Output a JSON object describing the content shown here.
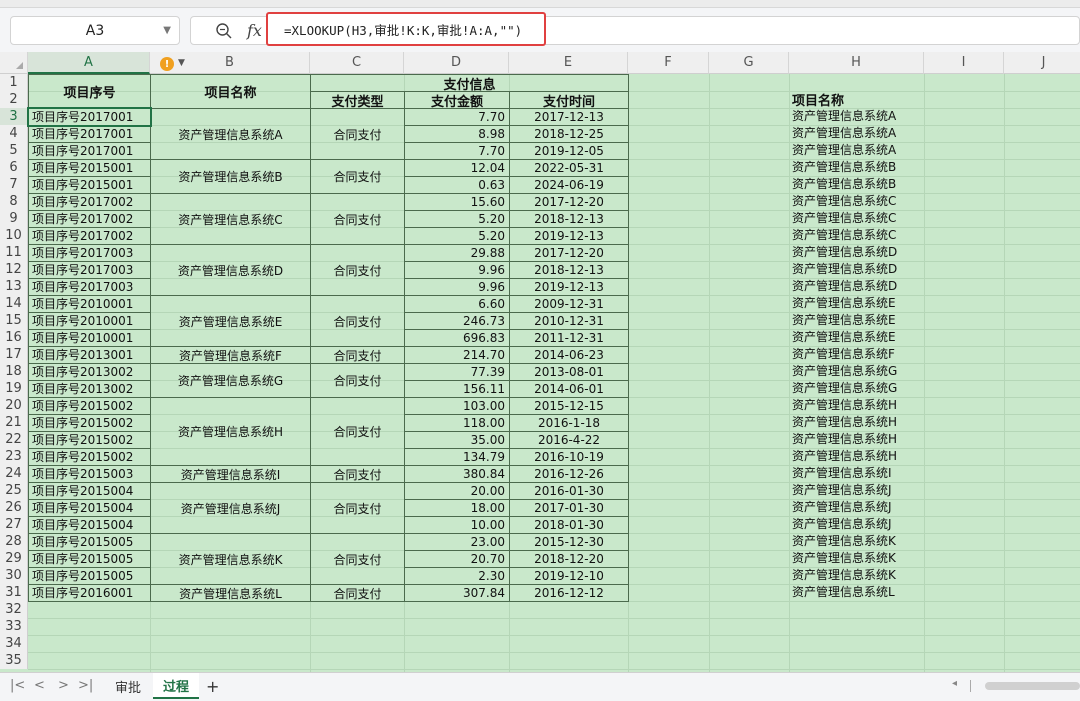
{
  "formula_bar": {
    "name_box": "A3",
    "fx_label": "fx",
    "formula": "=XLOOKUP(H3,审批!K:K,审批!A:A,\"\")"
  },
  "columns": [
    "A",
    "B",
    "C",
    "D",
    "E",
    "F",
    "G",
    "H",
    "I",
    "J"
  ],
  "row_numbers": [
    "1",
    "2",
    "3",
    "4",
    "5",
    "6",
    "7",
    "8",
    "9",
    "10",
    "11",
    "12",
    "13",
    "14",
    "15",
    "16",
    "17",
    "18",
    "19",
    "20",
    "21",
    "22",
    "23",
    "24",
    "25",
    "26",
    "27",
    "28",
    "29",
    "30",
    "31",
    "32",
    "33",
    "34",
    "35"
  ],
  "headers": {
    "project_no": "项目序号",
    "project_name": "项目名称",
    "payment_info": "支付信息",
    "payment_type": "支付类型",
    "payment_amount": "支付金额",
    "payment_time": "支付时间",
    "lookup_header": "项目名称"
  },
  "rows": [
    {
      "no": "项目序号2017001",
      "amount": "7.70",
      "date": "2017-12-13",
      "h": "资产管理信息系统A"
    },
    {
      "no": "项目序号2017001",
      "amount": "8.98",
      "date": "2018-12-25",
      "h": "资产管理信息系统A"
    },
    {
      "no": "项目序号2017001",
      "amount": "7.70",
      "date": "2019-12-05",
      "h": "资产管理信息系统A"
    },
    {
      "no": "项目序号2015001",
      "amount": "12.04",
      "date": "2022-05-31",
      "h": "资产管理信息系统B"
    },
    {
      "no": "项目序号2015001",
      "amount": "0.63",
      "date": "2024-06-19",
      "h": "资产管理信息系统B"
    },
    {
      "no": "项目序号2017002",
      "amount": "15.60",
      "date": "2017-12-20",
      "h": "资产管理信息系统C"
    },
    {
      "no": "项目序号2017002",
      "amount": "5.20",
      "date": "2018-12-13",
      "h": "资产管理信息系统C"
    },
    {
      "no": "项目序号2017002",
      "amount": "5.20",
      "date": "2019-12-13",
      "h": "资产管理信息系统C"
    },
    {
      "no": "项目序号2017003",
      "amount": "29.88",
      "date": "2017-12-20",
      "h": "资产管理信息系统D"
    },
    {
      "no": "项目序号2017003",
      "amount": "9.96",
      "date": "2018-12-13",
      "h": "资产管理信息系统D"
    },
    {
      "no": "项目序号2017003",
      "amount": "9.96",
      "date": "2019-12-13",
      "h": "资产管理信息系统D"
    },
    {
      "no": "项目序号2010001",
      "amount": "6.60",
      "date": "2009-12-31",
      "h": "资产管理信息系统E"
    },
    {
      "no": "项目序号2010001",
      "amount": "246.73",
      "date": "2010-12-31",
      "h": "资产管理信息系统E"
    },
    {
      "no": "项目序号2010001",
      "amount": "696.83",
      "date": "2011-12-31",
      "h": "资产管理信息系统E"
    },
    {
      "no": "项目序号2013001",
      "amount": "214.70",
      "date": "2014-06-23",
      "h": "资产管理信息系统F"
    },
    {
      "no": "项目序号2013002",
      "amount": "77.39",
      "date": "2013-08-01",
      "h": "资产管理信息系统G"
    },
    {
      "no": "项目序号2013002",
      "amount": "156.11",
      "date": "2014-06-01",
      "h": "资产管理信息系统G"
    },
    {
      "no": "项目序号2015002",
      "amount": "103.00",
      "date": "2015-12-15",
      "h": "资产管理信息系统H"
    },
    {
      "no": "项目序号2015002",
      "amount": "118.00",
      "date": "2016-1-18",
      "h": "资产管理信息系统H"
    },
    {
      "no": "项目序号2015002",
      "amount": "35.00",
      "date": "2016-4-22",
      "h": "资产管理信息系统H"
    },
    {
      "no": "项目序号2015002",
      "amount": "134.79",
      "date": "2016-10-19",
      "h": "资产管理信息系统H"
    },
    {
      "no": "项目序号2015003",
      "amount": "380.84",
      "date": "2016-12-26",
      "h": "资产管理信息系统I"
    },
    {
      "no": "项目序号2015004",
      "amount": "20.00",
      "date": "2016-01-30",
      "h": "资产管理信息系统J"
    },
    {
      "no": "项目序号2015004",
      "amount": "18.00",
      "date": "2017-01-30",
      "h": "资产管理信息系统J"
    },
    {
      "no": "项目序号2015004",
      "amount": "10.00",
      "date": "2018-01-30",
      "h": "资产管理信息系统J"
    },
    {
      "no": "项目序号2015005",
      "amount": "23.00",
      "date": "2015-12-30",
      "h": "资产管理信息系统K"
    },
    {
      "no": "项目序号2015005",
      "amount": "20.70",
      "date": "2018-12-20",
      "h": "资产管理信息系统K"
    },
    {
      "no": "项目序号2015005",
      "amount": "2.30",
      "date": "2019-12-10",
      "h": "资产管理信息系统K"
    },
    {
      "no": "项目序号2016001",
      "amount": "307.84",
      "date": "2016-12-12",
      "h": "资产管理信息系统L"
    }
  ],
  "groups": [
    {
      "name": "资产管理信息系统A",
      "type": "合同支付",
      "start": 0,
      "span": 3
    },
    {
      "name": "资产管理信息系统B",
      "type": "合同支付",
      "start": 3,
      "span": 2
    },
    {
      "name": "资产管理信息系统C",
      "type": "合同支付",
      "start": 5,
      "span": 3
    },
    {
      "name": "资产管理信息系统D",
      "type": "合同支付",
      "start": 8,
      "span": 3
    },
    {
      "name": "资产管理信息系统E",
      "type": "合同支付",
      "start": 11,
      "span": 3
    },
    {
      "name": "资产管理信息系统F",
      "type": "合同支付",
      "start": 14,
      "span": 1
    },
    {
      "name": "资产管理信息系统G",
      "type": "合同支付",
      "start": 15,
      "span": 2
    },
    {
      "name": "资产管理信息系统H",
      "type": "合同支付",
      "start": 17,
      "span": 4
    },
    {
      "name": "资产管理信息系统I",
      "type": "合同支付",
      "start": 21,
      "span": 1
    },
    {
      "name": "资产管理信息系统J",
      "type": "合同支付",
      "start": 22,
      "span": 3
    },
    {
      "name": "资产管理信息系统K",
      "type": "合同支付",
      "start": 25,
      "span": 3
    },
    {
      "name": "资产管理信息系统L",
      "type": "合同支付",
      "start": 28,
      "span": 1
    }
  ],
  "sheet_tabs": [
    {
      "label": "审批",
      "active": false
    },
    {
      "label": "过程",
      "active": true
    }
  ],
  "add_sheet_label": "+",
  "colors": {
    "accent": "#217346",
    "grid_bg": "#c9e8cb",
    "formula_highlight": "#e04040",
    "warning": "#f0a020"
  }
}
